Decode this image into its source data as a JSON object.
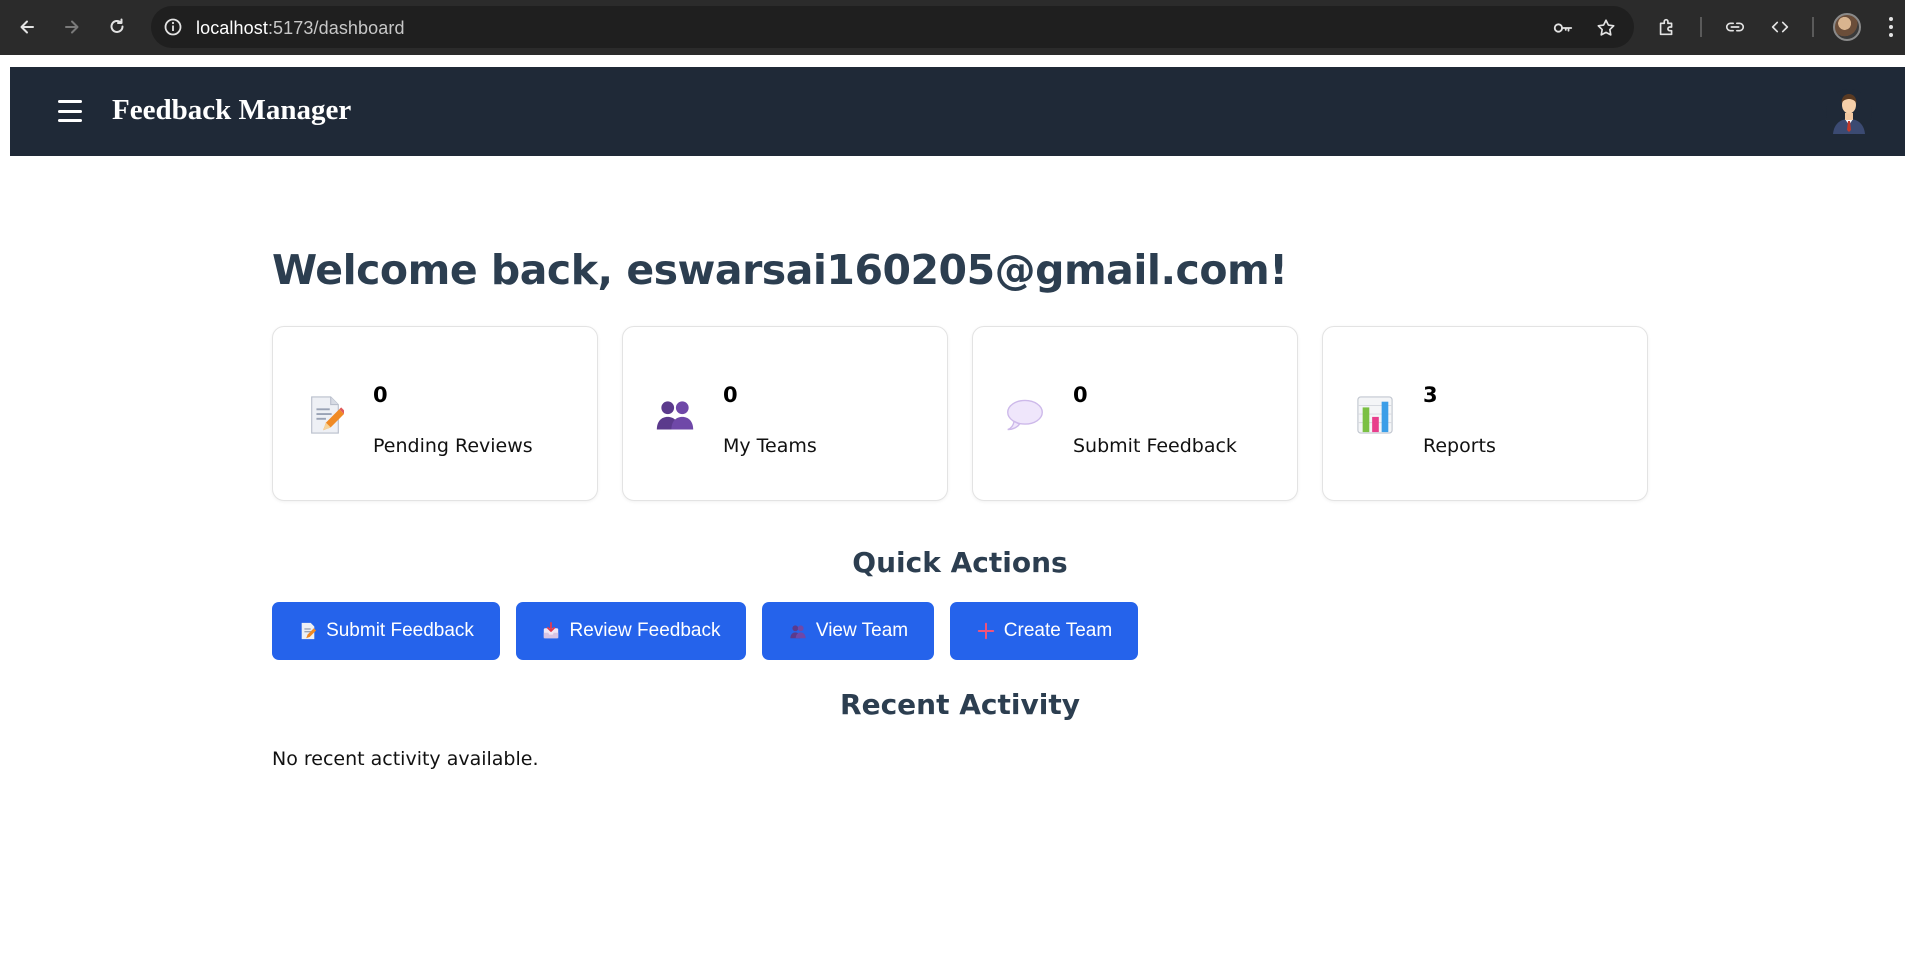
{
  "browser": {
    "url_host": "localhost",
    "url_path": ":5173/dashboard"
  },
  "header": {
    "brand": "Feedback Manager"
  },
  "main": {
    "welcome": "Welcome back, eswarsai160205@gmail.com!",
    "stats": [
      {
        "count": "0",
        "label": "Pending Reviews",
        "icon": "memo-icon"
      },
      {
        "count": "0",
        "label": "My Teams",
        "icon": "team-icon"
      },
      {
        "count": "0",
        "label": "Submit Feedback",
        "icon": "speech-bubble-icon"
      },
      {
        "count": "3",
        "label": "Reports",
        "icon": "bar-chart-icon"
      }
    ],
    "quick_actions_title": "Quick Actions",
    "actions": [
      {
        "label": "Submit Feedback",
        "icon": "memo-icon"
      },
      {
        "label": "Review Feedback",
        "icon": "inbox-tray-icon"
      },
      {
        "label": "View Team",
        "icon": "team-icon"
      },
      {
        "label": "Create Team",
        "icon": "plus-icon"
      }
    ],
    "recent_activity_title": "Recent Activity",
    "recent_activity_empty": "No recent activity available."
  },
  "colors": {
    "header_bg": "#1f2937",
    "primary_button": "#2563eb",
    "heading": "#2c3e50"
  }
}
